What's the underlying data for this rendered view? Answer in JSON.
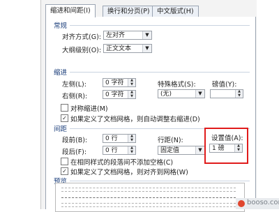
{
  "tabs": [
    "缩进和间距(I)",
    "换行和分页(P)",
    "中文版式(H)"
  ],
  "general": {
    "title": "常规",
    "alignment_label": "对齐方式(G):",
    "alignment_value": "左对齐",
    "outline_label": "大纲级别(O):",
    "outline_value": "正文文本"
  },
  "indent": {
    "title": "缩进",
    "left_label": "左侧(L):",
    "left_value": "0 字符",
    "right_label": "右侧(R):",
    "right_value": "0 字符",
    "special_label": "特殊格式(S):",
    "special_value": "(无)",
    "by_label": "磅值(Y):",
    "by_value": "",
    "mirror_label": "对称缩进(M)",
    "mirror_checked": false,
    "auto_label": "如果定义了文档网格，则自动调整右缩进(D)",
    "auto_checked": true
  },
  "spacing": {
    "title": "间距",
    "before_label": "段前(B):",
    "before_value": "0 行",
    "after_label": "段后(F):",
    "after_value": "0 行",
    "line_label": "行距(N):",
    "line_value": "固定值",
    "at_label": "设置值(A):",
    "at_value": "1 磅",
    "nospace_label": "在相同样式的段落间不添加空格(C)",
    "nospace_checked": false,
    "snap_label": "如果定义了文档网格，则对齐到网格(W)",
    "snap_checked": true
  },
  "preview": {
    "title": "预览"
  },
  "watermark": "booso.com",
  "colors": {
    "highlight": "#e01b1b",
    "section_text": "#1a3d7a"
  }
}
